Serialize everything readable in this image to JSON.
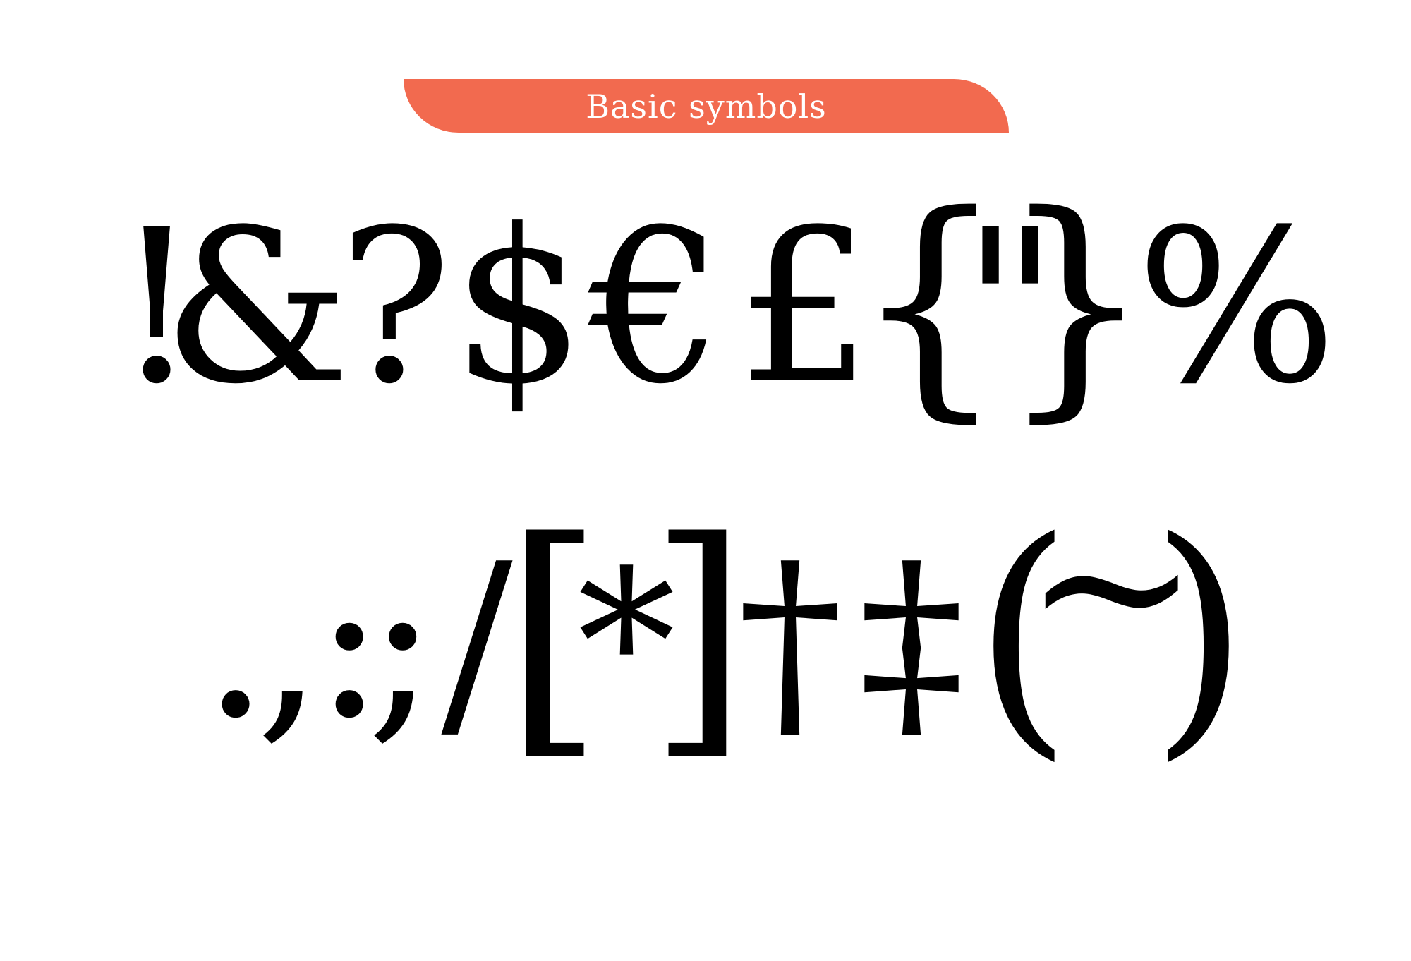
{
  "title": {
    "text": "Basic symbols",
    "background_color": "#F26A4F",
    "text_color": "#FFFFFF"
  },
  "rows": [
    {
      "glyphs": [
        "!",
        "&",
        "?",
        "$",
        "€",
        "£",
        "{",
        "\"",
        "}",
        "%"
      ]
    },
    {
      "glyphs": [
        ".",
        ",",
        ":",
        ";",
        "/",
        "[",
        "*",
        "]",
        "†",
        "‡",
        "(",
        "~",
        ")"
      ]
    }
  ],
  "glyph_color": "#000000",
  "background_color": "#FFFFFF"
}
